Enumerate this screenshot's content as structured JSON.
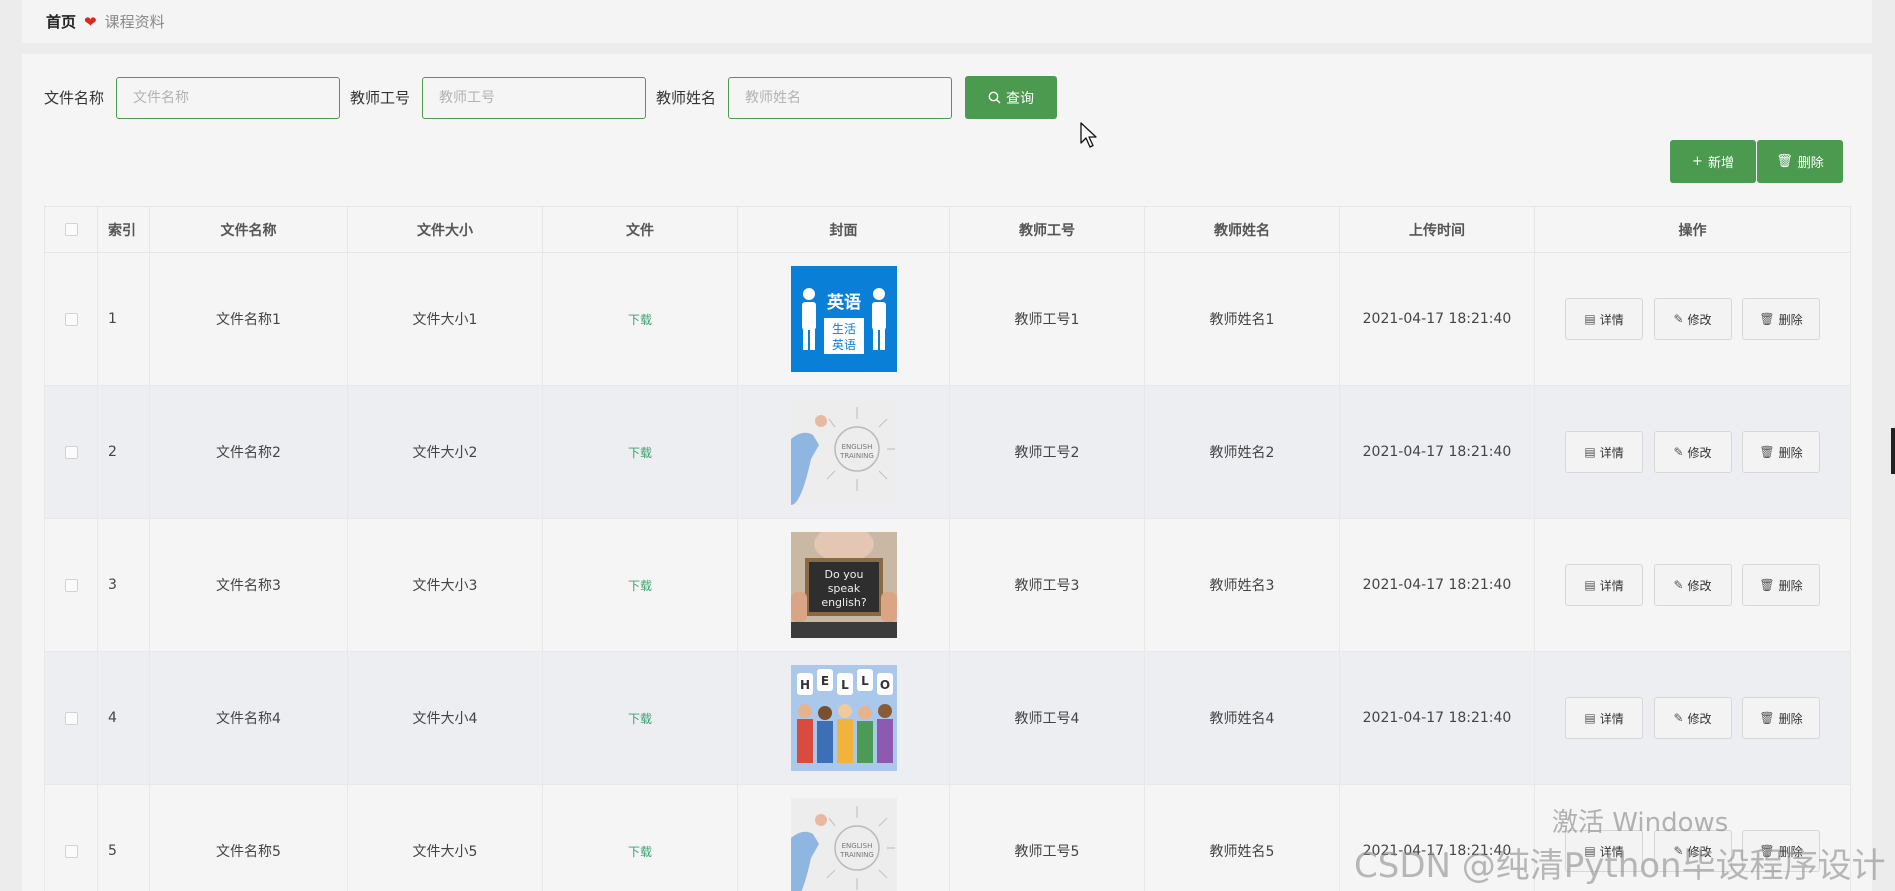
{
  "breadcrumb": {
    "home": "首页",
    "current": "课程资料"
  },
  "search": {
    "file_name_label": "文件名称",
    "file_name_placeholder": "文件名称",
    "teacher_no_label": "教师工号",
    "teacher_no_placeholder": "教师工号",
    "teacher_name_label": "教师姓名",
    "teacher_name_placeholder": "教师姓名",
    "query_label": "查询"
  },
  "actions": {
    "add_label": "新增",
    "delete_label": "删除"
  },
  "table": {
    "headers": [
      "索引",
      "文件名称",
      "文件大小",
      "文件",
      "封面",
      "教师工号",
      "教师姓名",
      "上传时间",
      "操作"
    ],
    "rows": [
      {
        "index": "1",
        "file_name": "文件名称1",
        "file_size": "文件大小1",
        "file": "下载",
        "cover": "英语 生活 英语",
        "teacher_no": "教师工号1",
        "teacher_name": "教师姓名1",
        "upload_time": "2021-04-17 18:21:40"
      },
      {
        "index": "2",
        "file_name": "文件名称2",
        "file_size": "文件大小2",
        "file": "下载",
        "cover": "",
        "teacher_no": "教师工号2",
        "teacher_name": "教师姓名2",
        "upload_time": "2021-04-17 18:21:40"
      },
      {
        "index": "3",
        "file_name": "文件名称3",
        "file_size": "文件大小3",
        "file": "下载",
        "cover": "Do you speak english?",
        "teacher_no": "教师工号3",
        "teacher_name": "教师姓名3",
        "upload_time": "2021-04-17 18:21:40"
      },
      {
        "index": "4",
        "file_name": "文件名称4",
        "file_size": "文件大小4",
        "file": "下载",
        "cover": "HELLO",
        "teacher_no": "教师工号4",
        "teacher_name": "教师姓名4",
        "upload_time": "2021-04-17 18:21:40"
      },
      {
        "index": "5",
        "file_name": "文件名称5",
        "file_size": "文件大小5",
        "file": "下载",
        "cover": "",
        "teacher_no": "教师工号5",
        "teacher_name": "教师姓名5",
        "upload_time": "2021-04-17 18:21:40"
      }
    ],
    "row_actions": {
      "detail": "详情",
      "edit": "修改",
      "delete": "删除"
    }
  },
  "watermark": {
    "windows": "激活 Windows",
    "csdn": "CSDN @纯清Python毕设程序设计"
  },
  "colors": {
    "accent": "#4c9a50",
    "heart": "#e0261c",
    "link": "#3da170"
  },
  "icons": [
    "heart-icon",
    "search-icon",
    "plus-icon",
    "trash-icon",
    "document-icon",
    "edit-icon",
    "cursor-icon"
  ]
}
